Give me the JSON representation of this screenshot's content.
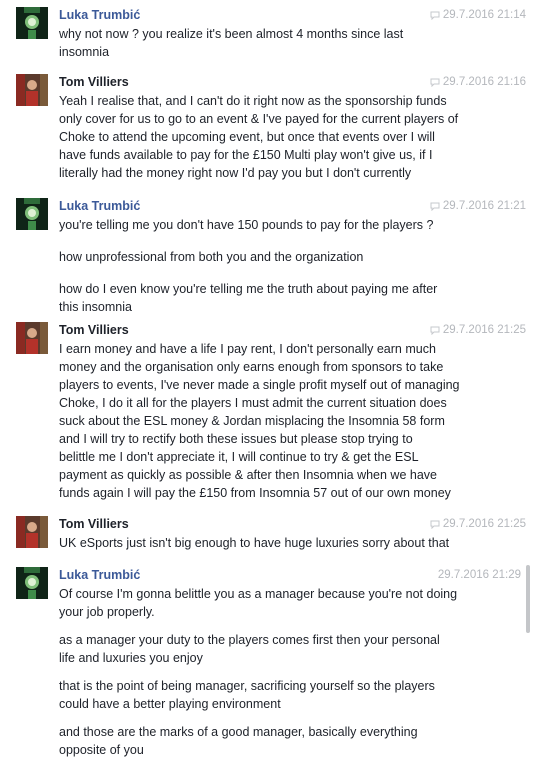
{
  "messages": [
    {
      "sender": "Luka Trumbić",
      "timestamp": "29.7.2016 21:14",
      "paragraphs": [
        [
          "why not now ? you realize it's been almost 4 months since last",
          "insomnia"
        ]
      ]
    },
    {
      "sender": "Tom Villiers",
      "timestamp": "29.7.2016 21:16",
      "paragraphs": [
        [
          "Yeah I realise that, and I can't do it right now as the sponsorship funds",
          "only cover for us to go to an event & I've payed for the current players of",
          "Choke to attend the upcoming event, but once that events over I will",
          "have funds available to pay for the £150 Multi play won't give us, if I",
          "literally had the money right now I'd pay you but I don't currently"
        ]
      ]
    },
    {
      "sender": "Luka Trumbić",
      "timestamp": "29.7.2016 21:21",
      "paragraphs": [
        [
          "you're telling me you don't have 150 pounds to pay for the players ?"
        ],
        [
          "how unprofessional from both you and the organization"
        ],
        [
          "how do I even know you're telling me the truth about paying me after",
          "this insomnia"
        ]
      ]
    },
    {
      "sender": "Tom Villiers",
      "timestamp": "29.7.2016 21:25",
      "paragraphs": [
        [
          "I earn money and have a life I pay rent, I don't personally earn much",
          "money and the organisation only earns enough from sponsors to take",
          "players to events, I've never made a single profit myself out of managing",
          "Choke, I do it all for the players I must admit the current situation does",
          "suck about the ESL money & Jordan misplacing the Insomnia 58 form",
          "and I will try to rectify both these issues but please stop trying to",
          "belittle me I don't appreciate it, I will continue to try & get the ESL",
          "payment as quickly as possible & after then Insomnia when we have",
          "funds again I will pay the £150 from Insomnia 57 out of our own money"
        ]
      ]
    },
    {
      "sender": "Tom Villiers",
      "timestamp": "29.7.2016 21:25",
      "paragraphs": [
        [
          "UK eSports just isn't big enough to have huge luxuries sorry about that"
        ]
      ]
    },
    {
      "sender": "Luka Trumbić",
      "timestamp": "29.7.2016 21:29",
      "paragraphs": [
        [
          "Of course I'm gonna belittle you as a manager because you're not doing",
          "your job properly."
        ],
        [
          "as a manager your duty to the players comes first then your personal",
          "life and luxuries you enjoy"
        ],
        [
          "that is the point of being manager, sacrificing yourself so the players",
          "could have a better playing environment"
        ],
        [
          "and those are the marks of a good manager, basically everything",
          "opposite of you"
        ]
      ]
    }
  ],
  "colors": {
    "luka_name": "#3b5998",
    "tom_name": "#1d2129",
    "timestamp": "#b4b7bc",
    "text": "#1d2129"
  },
  "icons": {
    "timestamp": "speech-bubble-icon",
    "luka_avatar": "green-avatar-icon",
    "tom_avatar": "red-avatar-icon"
  }
}
